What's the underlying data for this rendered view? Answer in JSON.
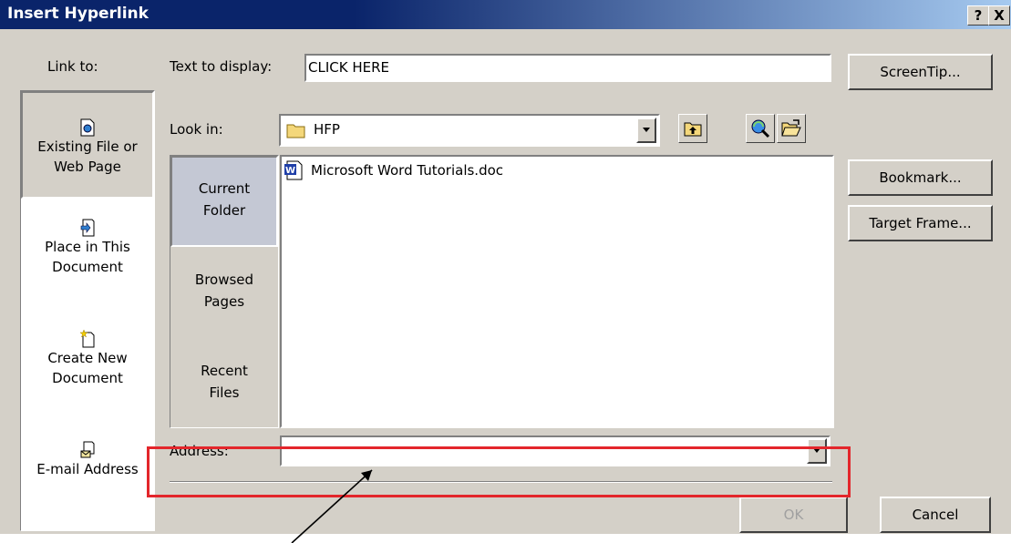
{
  "window": {
    "title": "Insert Hyperlink",
    "help_glyph": "?",
    "close_glyph": "X"
  },
  "link_to": {
    "heading": "Link to:",
    "items": [
      {
        "line1": "Existing File or",
        "line2": "Web Page",
        "selected": true,
        "icon": "web-page-icon"
      },
      {
        "line1": "Place in This",
        "line2": "Document",
        "selected": false,
        "icon": "place-in-document-icon"
      },
      {
        "line1": "Create New",
        "line2": "Document",
        "selected": false,
        "icon": "new-document-icon"
      },
      {
        "line1": "E-mail Address",
        "line2": "",
        "selected": false,
        "icon": "email-icon"
      }
    ]
  },
  "text_to_display": {
    "label": "Text to display:",
    "value": "CLICK HERE"
  },
  "screentip_label": "ScreenTip...",
  "look_in": {
    "label": "Look in:",
    "value": "HFP"
  },
  "nav": {
    "items": [
      {
        "line1": "Current",
        "line2": "Folder",
        "selected": true
      },
      {
        "line1": "Browsed",
        "line2": "Pages",
        "selected": false
      },
      {
        "line1": "Recent",
        "line2": "Files",
        "selected": false
      }
    ]
  },
  "files": [
    {
      "name": "Microsoft Word Tutorials.doc",
      "icon": "word-doc-icon"
    }
  ],
  "side_buttons": {
    "bookmark": "Bookmark...",
    "target_frame": "Target Frame..."
  },
  "address": {
    "label": "Address:",
    "value": ""
  },
  "footer": {
    "ok": "OK",
    "cancel": "Cancel"
  },
  "colors": {
    "title_start": "#0a246a",
    "title_end": "#a6caf0",
    "face": "#d4d0c8",
    "highlight_box": "#e3262b"
  }
}
